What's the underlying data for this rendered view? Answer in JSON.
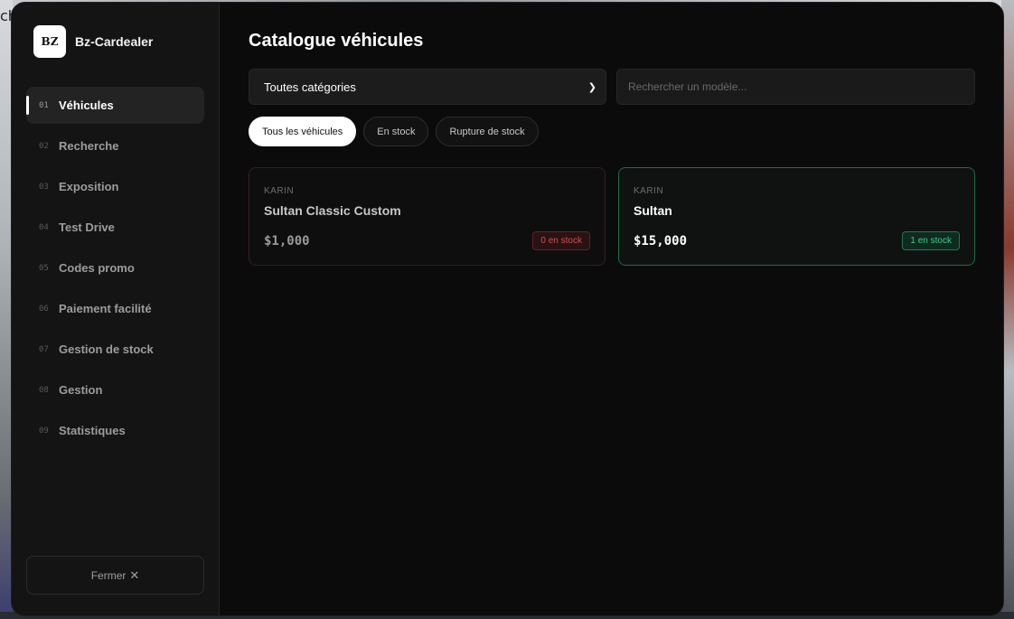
{
  "brand": {
    "logo_text": "BZ",
    "name": "Bz-Cardealer"
  },
  "background": {
    "edge_text": "ch"
  },
  "nav": {
    "items": [
      {
        "num": "01",
        "label": "Véhicules",
        "active": true
      },
      {
        "num": "02",
        "label": "Recherche"
      },
      {
        "num": "03",
        "label": "Exposition"
      },
      {
        "num": "04",
        "label": "Test Drive"
      },
      {
        "num": "05",
        "label": "Codes promo"
      },
      {
        "num": "06",
        "label": "Paiement facilité"
      },
      {
        "num": "07",
        "label": "Gestion de stock"
      },
      {
        "num": "08",
        "label": "Gestion"
      },
      {
        "num": "09",
        "label": "Statistiques"
      }
    ]
  },
  "close": {
    "label": "Fermer",
    "icon": "close-icon"
  },
  "page": {
    "title": "Catalogue véhicules"
  },
  "category_select": {
    "value": "Toutes catégories",
    "icon": "chevron-down-icon"
  },
  "search": {
    "placeholder": "Rechercher un modèle..."
  },
  "filters": [
    {
      "label": "Tous les véhicules",
      "active": true
    },
    {
      "label": "En stock"
    },
    {
      "label": "Rupture de stock"
    }
  ],
  "vehicles": [
    {
      "brand": "KARIN",
      "model": "Sultan Classic Custom",
      "price": "$1,000",
      "stock": "0 en stock",
      "status": "out"
    },
    {
      "brand": "KARIN",
      "model": "Sultan",
      "price": "$15,000",
      "stock": "1 en stock",
      "status": "in"
    }
  ],
  "colors": {
    "in_stock": "#3ccf86",
    "out_of_stock": "#d0524f",
    "accent": "#ffffff"
  }
}
